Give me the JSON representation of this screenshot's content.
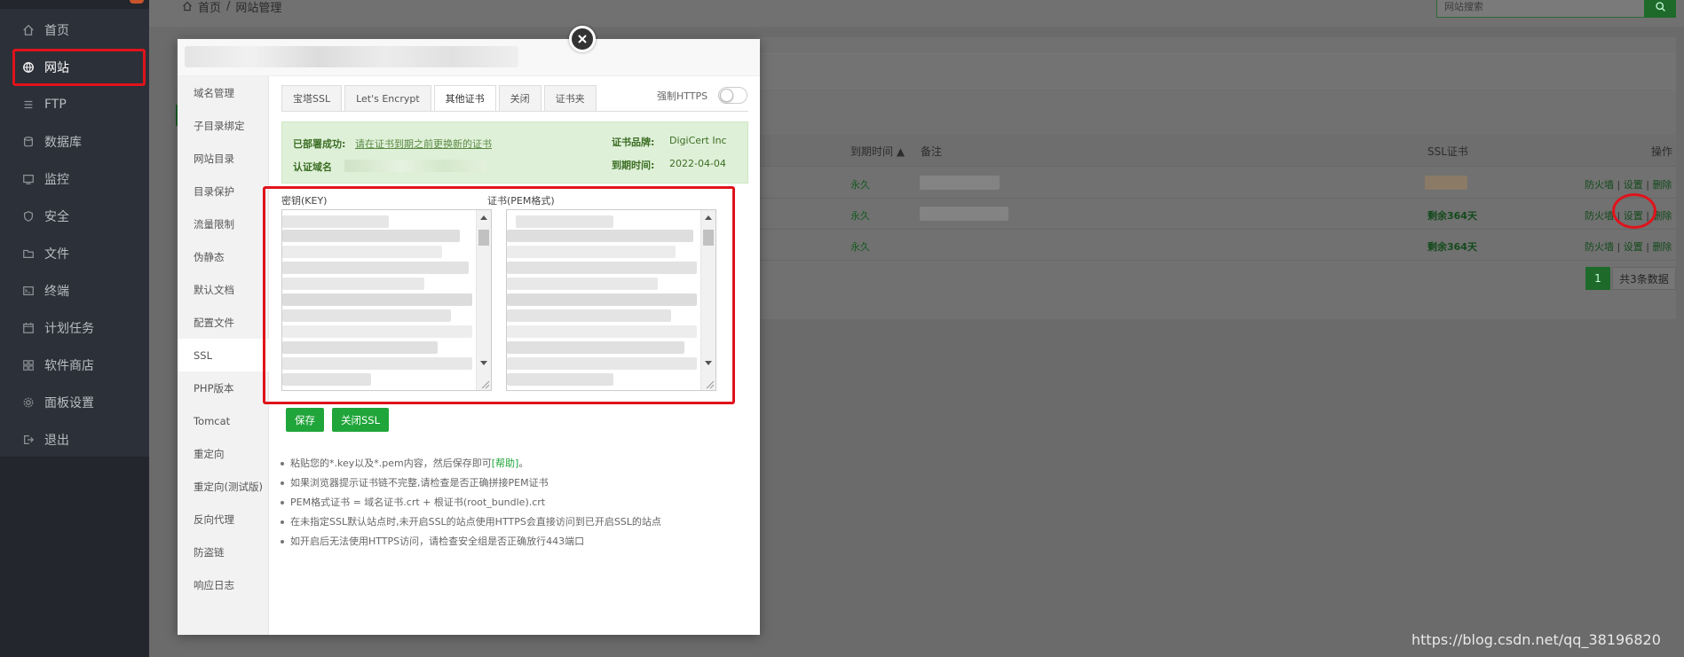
{
  "sidebar": {
    "items": [
      {
        "label": "首页",
        "icon": "home-icon"
      },
      {
        "label": "网站",
        "icon": "globe-icon",
        "active": true
      },
      {
        "label": "FTP",
        "icon": "ftp-icon"
      },
      {
        "label": "数据库",
        "icon": "database-icon"
      },
      {
        "label": "监控",
        "icon": "monitor-icon"
      },
      {
        "label": "安全",
        "icon": "shield-icon"
      },
      {
        "label": "文件",
        "icon": "folder-icon"
      },
      {
        "label": "终端",
        "icon": "terminal-icon"
      },
      {
        "label": "计划任务",
        "icon": "calendar-icon"
      },
      {
        "label": "软件商店",
        "icon": "grid-icon"
      },
      {
        "label": "面板设置",
        "icon": "gear-icon"
      },
      {
        "label": "退出",
        "icon": "logout-icon"
      }
    ]
  },
  "breadcrumb": {
    "home": "首页",
    "separator": "/",
    "current": "网站管理"
  },
  "search": {
    "placeholder": "网站搜索"
  },
  "table": {
    "headers": {
      "expire": "到期时间",
      "remark": "备注",
      "ssl": "SSL证书",
      "actions": "操作"
    },
    "rows": [
      {
        "expire": "永久",
        "ssl": "",
        "firewall": "防火墙",
        "settings": "设置",
        "delete": "删除"
      },
      {
        "expire": "永久",
        "ssl": "剩余364天",
        "firewall": "防火墙",
        "settings": "设置",
        "delete": "删除"
      },
      {
        "expire": "永久",
        "ssl": "剩余364天",
        "firewall": "防火墙",
        "settings": "设置",
        "delete": "删除"
      }
    ],
    "separator": "|",
    "pagination": {
      "current": "1",
      "total": "共3条数据"
    }
  },
  "modal": {
    "menu": [
      "域名管理",
      "子目录绑定",
      "网站目录",
      "目录保护",
      "流量限制",
      "伪静态",
      "默认文档",
      "配置文件",
      "SSL",
      "PHP版本",
      "Tomcat",
      "重定向",
      "重定向(测试版)",
      "反向代理",
      "防盗链",
      "响应日志"
    ],
    "active_menu": "SSL",
    "tabs": [
      "宝塔SSL",
      "Let's Encrypt",
      "其他证书",
      "关闭",
      "证书夹"
    ],
    "active_tab": "其他证书",
    "force_https_label": "强制HTTPS",
    "ssl_info": {
      "deployed_label": "已部署成功:",
      "deployed_note": "请在证书到期之前更换新的证书",
      "domain_label": "认证域名",
      "brand_label": "证书品牌:",
      "brand_value": "DigiCert Inc",
      "expire_label": "到期时间:",
      "expire_value": "2022-04-04"
    },
    "key_label": "密钥(KEY)",
    "cert_label": "证书(PEM格式)",
    "save_button": "保存",
    "close_ssl_button": "关闭SSL",
    "notes": {
      "n1_pre": "粘贴您的*.key以及*.pem内容，然后保存即可",
      "n1_help": "[帮助]",
      "n1_post": "。",
      "n2": "如果浏览器提示证书链不完整,请检查是否正确拼接PEM证书",
      "n3": "PEM格式证书 = 域名证书.crt + 根证书(root_bundle).crt",
      "n4": "在未指定SSL默认站点时,未开启SSL的站点使用HTTPS会直接访问到已开启SSL的站点",
      "n5": "如开启后无法使用HTTPS访问，请检查安全组是否正确放行443端口"
    }
  },
  "watermark": "https://blog.csdn.net/qq_38196820",
  "colors": {
    "accent": "#20a53a",
    "highlight": "#e0131b",
    "sidebar": "#2c3038"
  }
}
